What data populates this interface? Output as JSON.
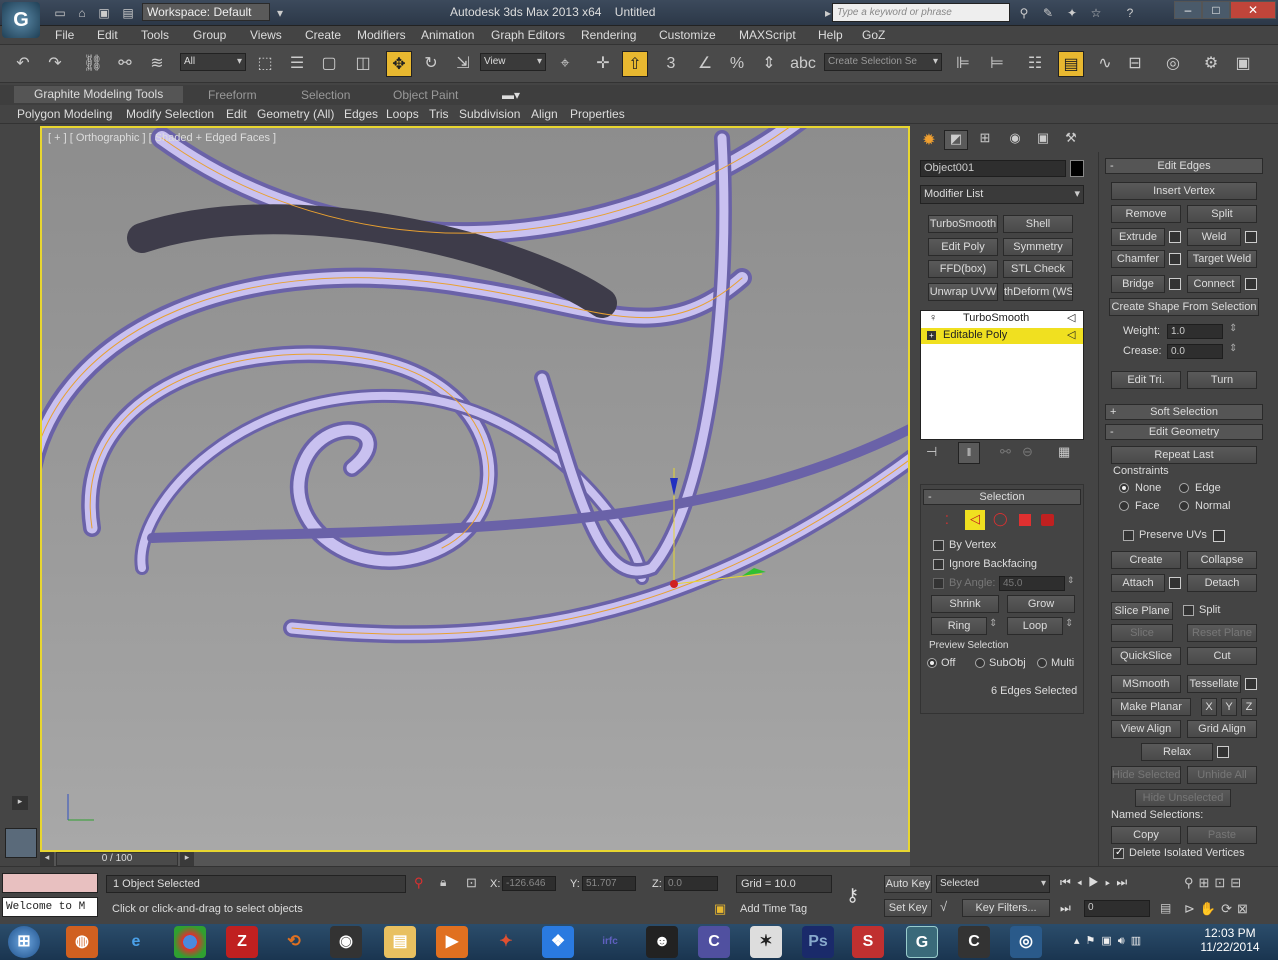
{
  "title": {
    "workspace": "Workspace: Default",
    "app": "Autodesk 3ds Max  2013 x64",
    "doc": "Untitled",
    "search_placeholder": "Type a keyword or phrase"
  },
  "menu": [
    "File",
    "Edit",
    "Tools",
    "Group",
    "Views",
    "Create",
    "Modifiers",
    "Animation",
    "Graph Editors",
    "Rendering",
    "Customize",
    "MAXScript",
    "Help",
    "GoZ"
  ],
  "toolbar": {
    "filter": "All",
    "refcoord": "View",
    "snap_num": "3",
    "named_sel": "Create Selection Se"
  },
  "ribbon": {
    "tabs": [
      "Graphite Modeling Tools",
      "Freeform",
      "Selection",
      "Object Paint"
    ],
    "items": [
      "Polygon Modeling",
      "Modify Selection",
      "Edit",
      "Geometry (All)",
      "Edges",
      "Loops",
      "Tris",
      "Subdivision",
      "Align",
      "Properties"
    ]
  },
  "viewport": {
    "label": "[ + ] [ Orthographic ] [ Shaded + Edged Faces ]"
  },
  "timeline": {
    "frame": "0 / 100"
  },
  "modify": {
    "object_name": "Object001",
    "modifier_list": "Modifier List",
    "mod_buttons": [
      "TurboSmooth",
      "Shell",
      "Edit Poly",
      "Symmetry",
      "FFD(box)",
      "STL Check",
      "Unwrap UVW",
      "thDeform (WSI"
    ],
    "stack": [
      "TurboSmooth",
      "Editable Poly"
    ]
  },
  "selection": {
    "header": "Selection",
    "by_vertex": "By Vertex",
    "ignore_backfacing": "Ignore Backfacing",
    "by_angle": "By Angle:",
    "angle": "45.0",
    "shrink": "Shrink",
    "grow": "Grow",
    "ring": "Ring",
    "loop": "Loop",
    "preview": "Preview Selection",
    "off": "Off",
    "subobj": "SubObj",
    "multi": "Multi",
    "count": "6 Edges Selected"
  },
  "edit_edges": {
    "header": "Edit Edges",
    "insert_vertex": "Insert Vertex",
    "remove": "Remove",
    "split": "Split",
    "extrude": "Extrude",
    "weld": "Weld",
    "chamfer": "Chamfer",
    "target_weld": "Target Weld",
    "bridge": "Bridge",
    "connect": "Connect",
    "create_shape": "Create Shape From Selection",
    "weight_label": "Weight:",
    "weight": "1.0",
    "crease_label": "Crease:",
    "crease": "0.0",
    "edit_tri": "Edit Tri.",
    "turn": "Turn"
  },
  "soft_selection": "Soft Selection",
  "edit_geometry": {
    "header": "Edit Geometry",
    "repeat_last": "Repeat Last",
    "constraints": "Constraints",
    "none": "None",
    "edge": "Edge",
    "face": "Face",
    "normal": "Normal",
    "preserve_uvs": "Preserve UVs",
    "create": "Create",
    "collapse": "Collapse",
    "attach": "Attach",
    "detach": "Detach",
    "slice_plane": "Slice Plane",
    "split": "Split",
    "slice": "Slice",
    "reset_plane": "Reset Plane",
    "quickslice": "QuickSlice",
    "cut": "Cut",
    "msmooth": "MSmooth",
    "tessellate": "Tessellate",
    "make_planar": "Make Planar",
    "x": "X",
    "y": "Y",
    "z": "Z",
    "view_align": "View Align",
    "grid_align": "Grid Align",
    "relax": "Relax",
    "hide_selected": "Hide Selected",
    "unhide_all": "Unhide All",
    "hide_unselected": "Hide Unselected",
    "named_selections": "Named Selections:",
    "copy": "Copy",
    "paste": "Paste",
    "delete_isolated": "Delete Isolated Vertices"
  },
  "status": {
    "listener": "Welcome to M",
    "selected": "1 Object Selected",
    "prompt": "Click or click-and-drag to select objects",
    "x_label": "X:",
    "x": "-126.646",
    "y_label": "Y:",
    "y": "51.707",
    "z_label": "Z:",
    "z": "0.0",
    "grid": "Grid = 10.0",
    "add_time_tag": "Add Time Tag",
    "auto_key": "Auto Key",
    "set_key": "Set Key",
    "selected_mode": "Selected",
    "key_filters": "Key Filters...",
    "frame": "0"
  },
  "taskbar": {
    "time": "12:03 PM",
    "date": "11/22/2014"
  }
}
